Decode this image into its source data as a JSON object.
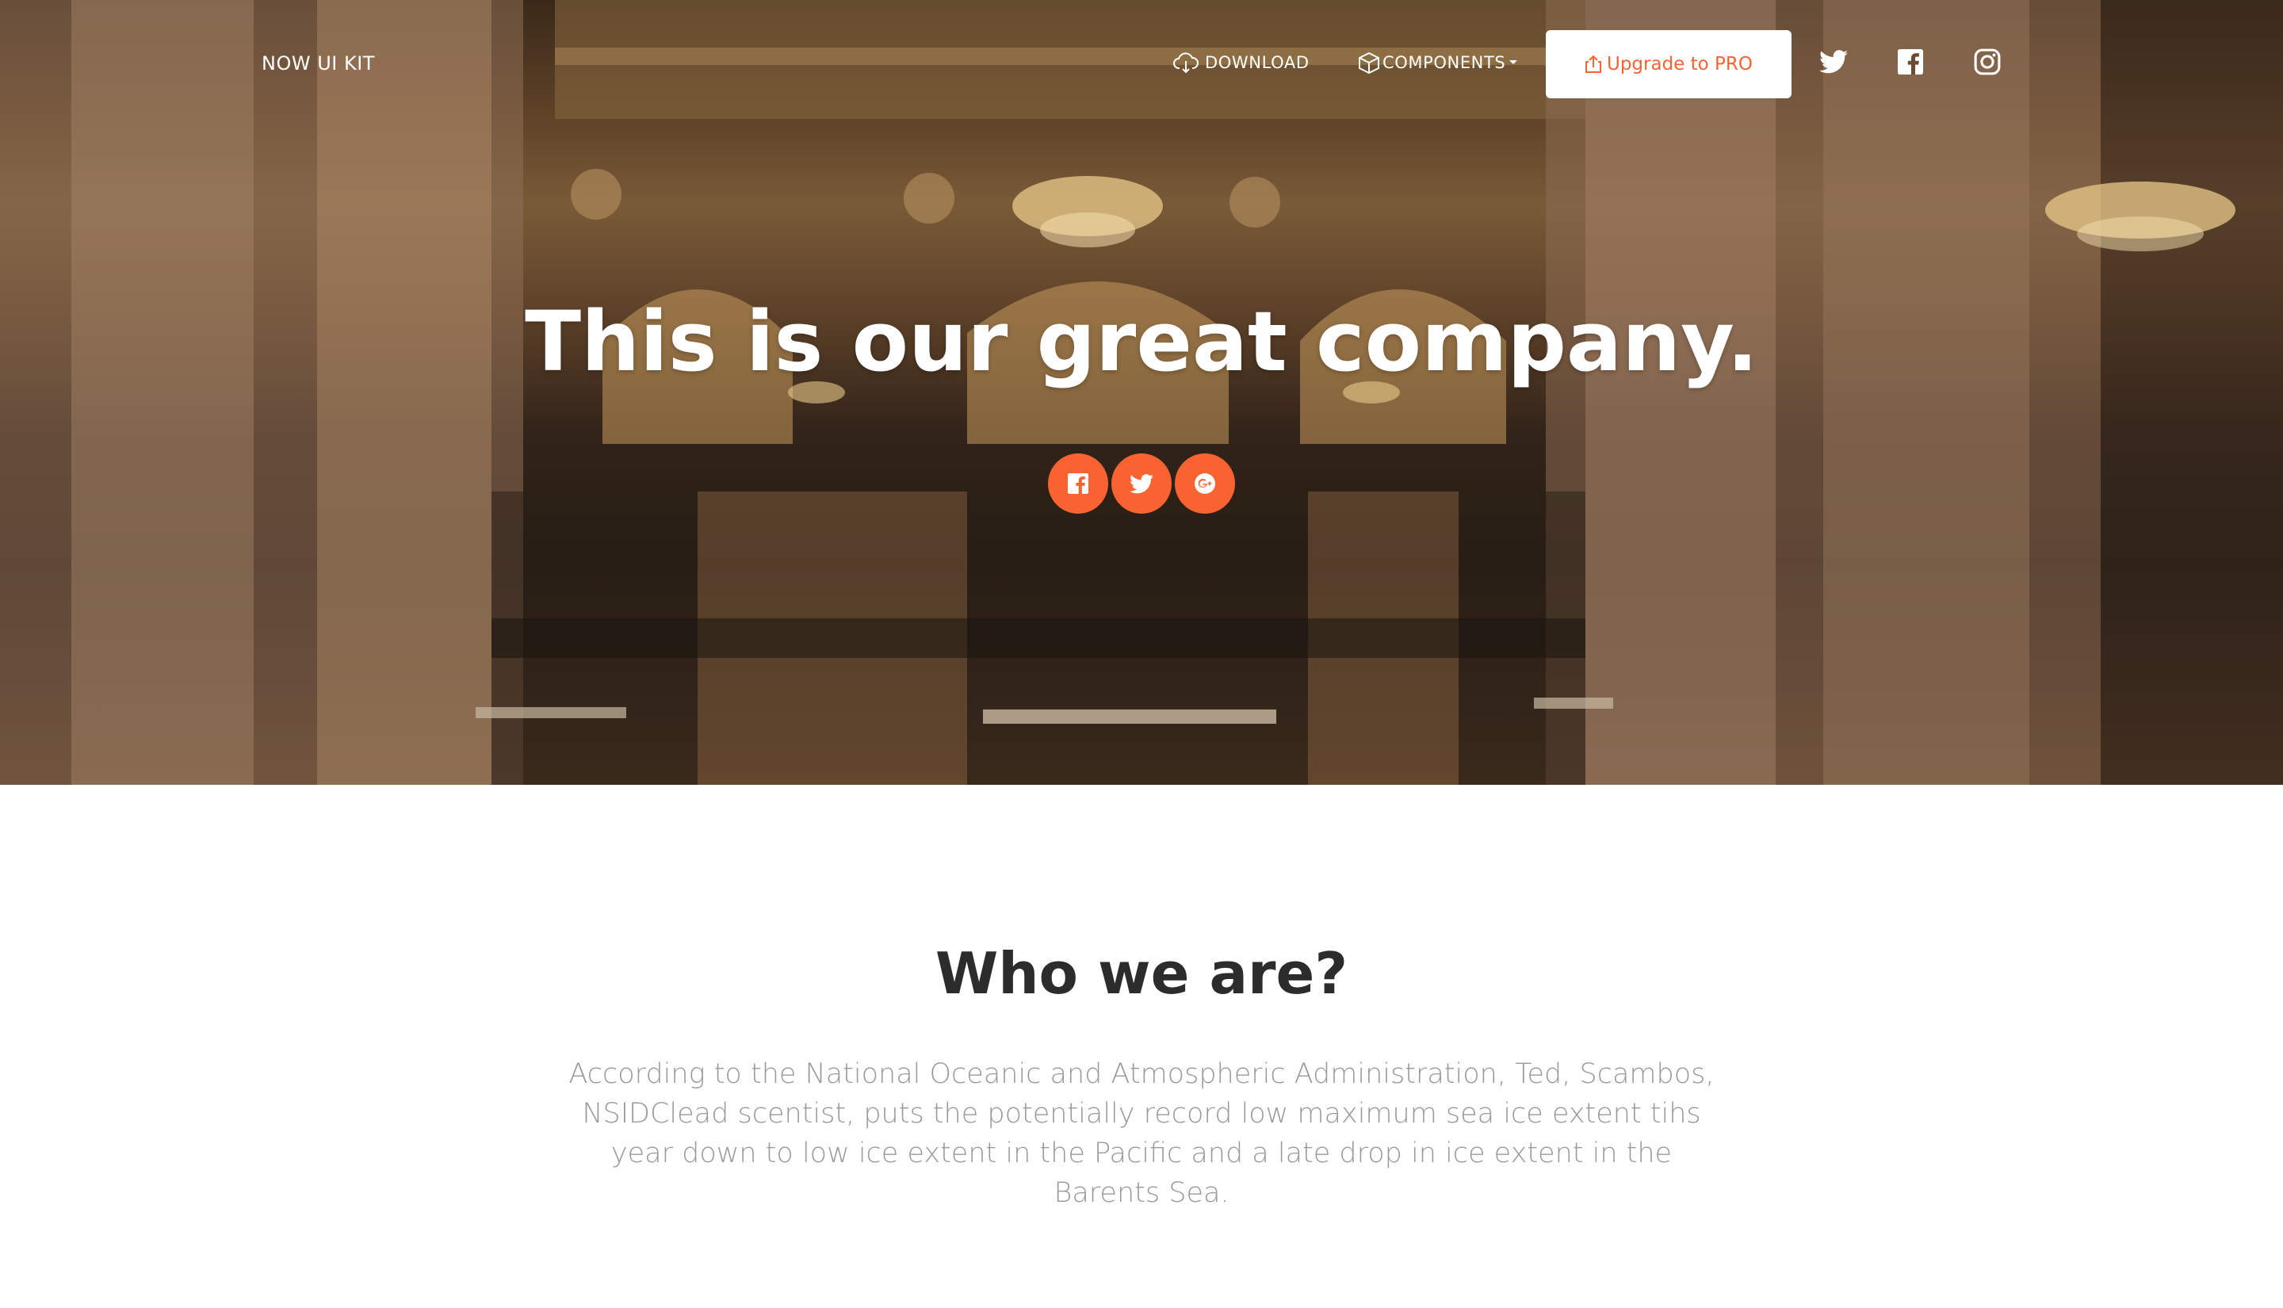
{
  "navbar": {
    "brand": "NOW UI KIT",
    "download_label": "DOWNLOAD",
    "components_label": "COMPONENTS",
    "upgrade_label": "Upgrade to PRO",
    "icons": [
      "cloud-download-icon",
      "box-icon",
      "caret-down-icon",
      "share-icon",
      "twitter-icon",
      "facebook-icon",
      "instagram-icon"
    ]
  },
  "hero": {
    "title": "This is our great company.",
    "social_buttons": [
      "facebook-icon",
      "twitter-icon",
      "google-plus-icon"
    ]
  },
  "about": {
    "title": "Who we are?",
    "text": "According to the National Oceanic and Atmospheric Administration, Ted, Scambos, NSIDClead scentist, puts the potentially record low maximum sea ice extent tihs year down to low ice extent in the Pacific and a late drop in ice extent in the Barents Sea."
  },
  "colors": {
    "accent": "#f96332",
    "heading": "#2c2c2c",
    "body_text": "#9a9a9a",
    "white": "#ffffff"
  }
}
